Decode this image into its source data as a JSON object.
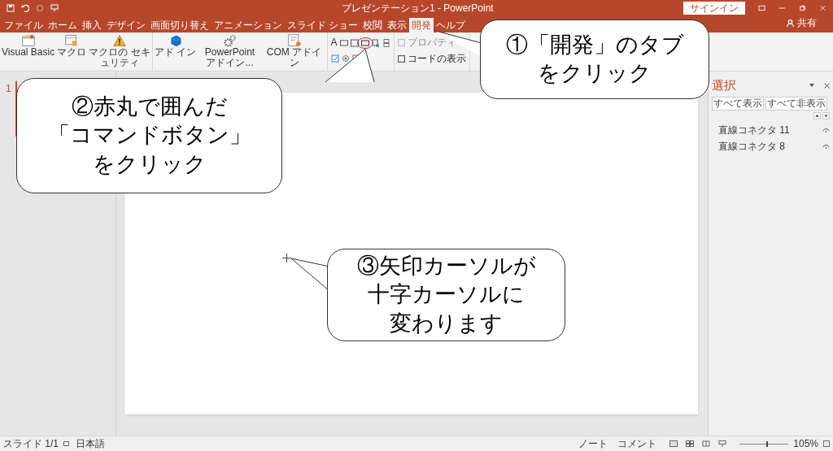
{
  "window": {
    "title": "プレゼンテーション1 - PowerPoint",
    "sign_in": "サインイン",
    "share": "共有"
  },
  "tabs": [
    {
      "label": "ファイル",
      "selected": false
    },
    {
      "label": "ホーム",
      "selected": false
    },
    {
      "label": "挿入",
      "selected": false
    },
    {
      "label": "デザイン",
      "selected": false
    },
    {
      "label": "画面切り替え",
      "selected": false
    },
    {
      "label": "アニメーション",
      "selected": false
    },
    {
      "label": "スライド ショー",
      "selected": false
    },
    {
      "label": "校閲",
      "selected": false
    },
    {
      "label": "表示",
      "selected": false
    },
    {
      "label": "開発",
      "selected": true
    },
    {
      "label": "ヘルプ",
      "selected": false
    }
  ],
  "ribbon": {
    "groups": [
      {
        "buttons": [
          {
            "kind": "vb",
            "label": "Visual Basic"
          },
          {
            "kind": "macro",
            "label": "マクロ"
          },
          {
            "kind": "security",
            "label": "マクロの セキュリティ"
          }
        ]
      },
      {
        "buttons": [
          {
            "kind": "addin",
            "label": "アド イン"
          },
          {
            "kind": "gear",
            "label": "PowerPoint アドイン..."
          },
          {
            "kind": "com",
            "label": "COM アドイン"
          }
        ]
      }
    ],
    "control_label": "A",
    "commands": [
      {
        "label": "プロパティ",
        "disabled": true
      },
      {
        "label": "コードの表示",
        "disabled": false
      }
    ]
  },
  "thumbnails": [
    {
      "number": "1",
      "selected": true
    }
  ],
  "selection_pane": {
    "title": "選択",
    "buttons": [
      "すべて表示",
      "すべて非表示"
    ],
    "items": [
      {
        "name": "直線コネクタ 11",
        "visible": true
      },
      {
        "name": "直線コネクタ 8",
        "visible": true
      }
    ]
  },
  "callouts": [
    {
      "lines": [
        "①「開発」のタブ",
        "をクリック"
      ]
    },
    {
      "lines": [
        "②赤丸で囲んだ",
        "「コマンドボタン」",
        "をクリック"
      ]
    },
    {
      "lines": [
        "③矢印カーソルが",
        "十字カーソルに",
        "変わります"
      ]
    }
  ],
  "status_bar": {
    "slide": "スライド 1/1",
    "language": "日本語",
    "notes": "ノート",
    "comments": "コメント",
    "zoom": "105%",
    "zoom_slider": {
      "level": 0.55
    }
  }
}
